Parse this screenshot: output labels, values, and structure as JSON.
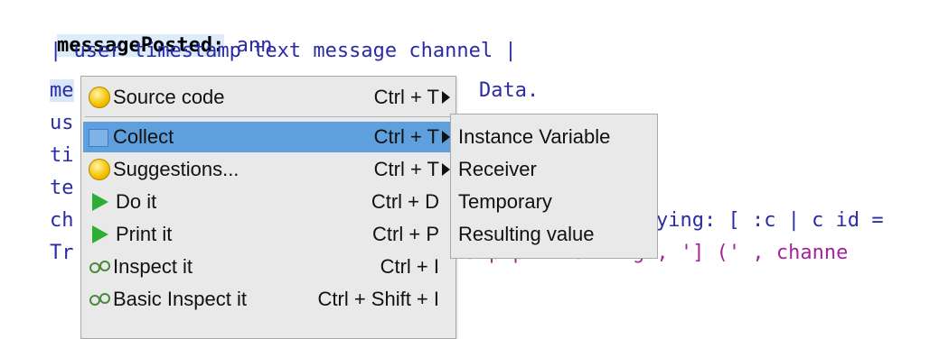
{
  "code": {
    "selector": "messagePosted:",
    "arg": " ann",
    "temps": "| user timestamp text message channel |",
    "line3_prefix": "me",
    "line3_suffix": "Data.",
    "line4_prefix": "us",
    "line5_prefix": "ti",
    "line6_prefix": "te",
    "line7_prefix": "ch",
    "line7_suffix": "ying: [ :c | c id =",
    "line8_prefix": "Tr",
    "line8_suffix": "stamp printString , '] (' , channe"
  },
  "menu": {
    "items": [
      {
        "label": "Source code",
        "shortcut": "Ctrl + T",
        "icon": "smiley-icon",
        "submenu": true
      },
      {
        "label": "Collect",
        "shortcut": "Ctrl + T",
        "icon": "collect-icon",
        "submenu": true,
        "active": true
      },
      {
        "label": "Suggestions...",
        "shortcut": "Ctrl + T",
        "icon": "smiley-icon",
        "submenu": true
      },
      {
        "label": "Do it",
        "shortcut": "Ctrl + D",
        "icon": "play-icon"
      },
      {
        "label": "Print it",
        "shortcut": "Ctrl + P",
        "icon": "play-icon"
      },
      {
        "label": "Inspect it",
        "shortcut": "Ctrl + I",
        "icon": "glasses-icon"
      },
      {
        "label": "Basic Inspect it",
        "shortcut": "Ctrl + Shift + I",
        "icon": "glasses-icon"
      }
    ]
  },
  "submenu": {
    "items": [
      "Instance Variable",
      "Receiver",
      "Temporary",
      "Resulting value"
    ]
  },
  "colors": {
    "menu_bg": "#e9e9e9",
    "active_bg": "#5ea0dd",
    "code_blue": "#2b2ba8",
    "string_purple": "#a5239b"
  }
}
